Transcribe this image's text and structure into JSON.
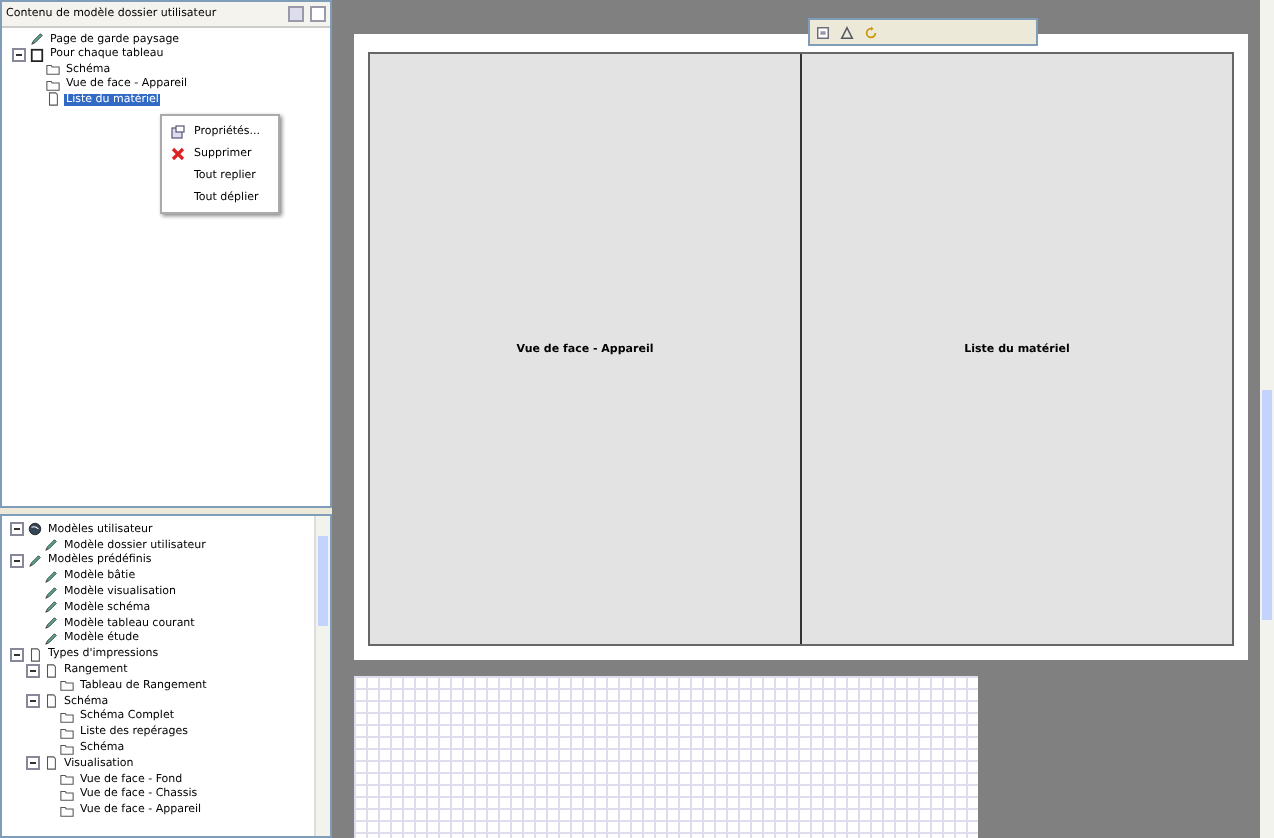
{
  "top_panel": {
    "title": "Contenu de modèle dossier utilisateur",
    "tree": [
      {
        "label": "Page de garde paysage",
        "kind": "model",
        "selected": false
      },
      {
        "label": "Pour chaque tableau",
        "kind": "group",
        "selected": false,
        "expanded": true,
        "children": [
          {
            "label": "Schéma",
            "kind": "view",
            "selected": false
          },
          {
            "label": "Vue de face - Appareil",
            "kind": "view",
            "selected": false
          },
          {
            "label": "Liste du matériel",
            "kind": "page",
            "selected": true
          }
        ]
      }
    ]
  },
  "context_menu": [
    {
      "label": "Propriétés...",
      "kind": "props"
    },
    {
      "label": "Supprimer",
      "kind": "delete"
    },
    {
      "label": "Tout replier",
      "kind": "plain"
    },
    {
      "label": "Tout déplier",
      "kind": "plain"
    }
  ],
  "bottom_panel": {
    "tree": [
      {
        "label": "Modèles utilisateur",
        "kind": "user",
        "expanded": true,
        "children": [
          {
            "label": "Modèle dossier utilisateur",
            "kind": "model"
          }
        ]
      },
      {
        "label": "Modèles prédéfinis",
        "kind": "model",
        "expanded": true,
        "children": [
          {
            "label": "Modèle bâtie",
            "kind": "model"
          },
          {
            "label": "Modèle visualisation",
            "kind": "model"
          },
          {
            "label": "Modèle schéma",
            "kind": "model"
          },
          {
            "label": "Modèle tableau courant",
            "kind": "model"
          },
          {
            "label": "Modèle étude",
            "kind": "model"
          }
        ]
      },
      {
        "label": "Types d'impressions",
        "kind": "page",
        "expanded": true,
        "children": [
          {
            "label": "Rangement",
            "kind": "page",
            "expanded": true,
            "children": [
              {
                "label": "Tableau de Rangement",
                "kind": "view"
              }
            ]
          },
          {
            "label": "Schéma",
            "kind": "page",
            "expanded": true,
            "children": [
              {
                "label": "Schéma Complet",
                "kind": "view"
              },
              {
                "label": "Liste des repérages",
                "kind": "view"
              },
              {
                "label": "Schéma",
                "kind": "view"
              }
            ]
          },
          {
            "label": "Visualisation",
            "kind": "page",
            "expanded": true,
            "children": [
              {
                "label": "Vue de face - Fond",
                "kind": "view"
              },
              {
                "label": "Vue de face - Chassis",
                "kind": "view"
              },
              {
                "label": "Vue de face - Appareil",
                "kind": "view"
              }
            ]
          }
        ]
      }
    ]
  },
  "page": {
    "columns": [
      "Vue de face - Appareil",
      "Liste du matériel"
    ]
  }
}
